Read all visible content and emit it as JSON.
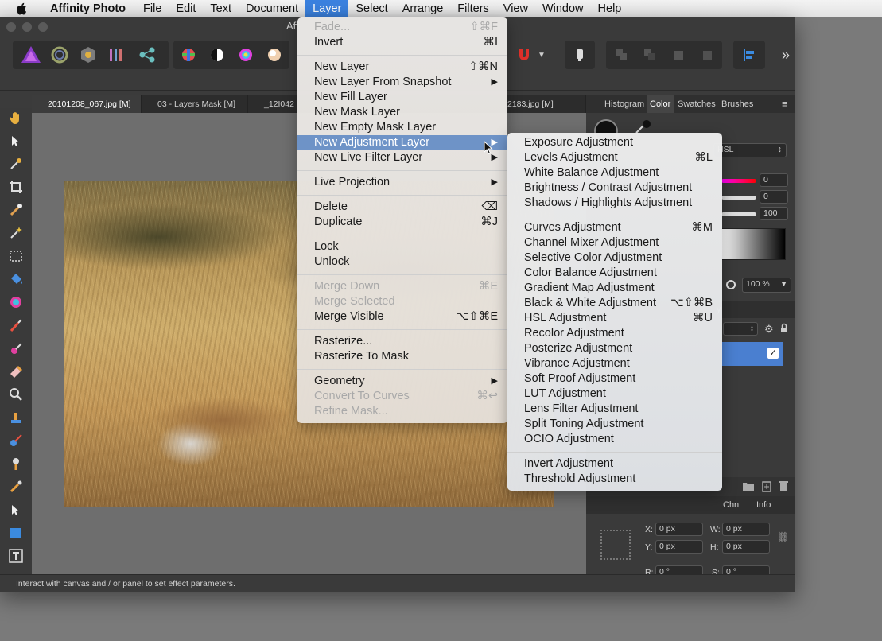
{
  "menubar": {
    "app": "Affinity Photo",
    "items": [
      "File",
      "Edit",
      "Text",
      "Document",
      "Layer",
      "Select",
      "Arrange",
      "Filters",
      "View",
      "Window",
      "Help"
    ]
  },
  "window": {
    "title": "Aff"
  },
  "doc_tabs": [
    "20101208_067.jpg [M]",
    "03 - Layers Mask [M]",
    "_12I042",
    "2183.jpg [M]"
  ],
  "right_panel": {
    "tabs": [
      "Histogram",
      "Color",
      "Swatches",
      "Brushes"
    ],
    "color_model": "HSL",
    "slider_values": [
      "0",
      "0",
      "100"
    ],
    "opacity": "100 %",
    "layers_tab_fragment": "y",
    "bottom_tabs": [
      "Chn",
      "Info"
    ],
    "transform": {
      "x_label": "X:",
      "x": "0 px",
      "y_label": "Y:",
      "y": "0 px",
      "w_label": "W:",
      "w": "0 px",
      "h_label": "H:",
      "h": "0 px",
      "r_label": "R:",
      "r": "0 °",
      "s_label": "S:",
      "s": "0 °"
    }
  },
  "status": "Interact with canvas and / or panel to set effect parameters.",
  "layer_menu": {
    "items": [
      {
        "label": "Fade...",
        "shortcut": "⇧⌘F",
        "disabled": true
      },
      {
        "label": "Invert",
        "shortcut": "⌘I"
      },
      {
        "label": "New Layer",
        "shortcut": "⇧⌘N"
      },
      {
        "label": "New Layer From Snapshot",
        "submenu": true
      },
      {
        "label": "New Fill Layer"
      },
      {
        "label": "New Mask Layer"
      },
      {
        "label": "New Empty Mask Layer"
      },
      {
        "label": "New Adjustment Layer",
        "submenu": true,
        "highlighted": true
      },
      {
        "label": "New Live Filter Layer",
        "submenu": true
      },
      {
        "label": "Live Projection",
        "submenu": true
      },
      {
        "label": "Delete",
        "shortcut": "⌫"
      },
      {
        "label": "Duplicate",
        "shortcut": "⌘J"
      },
      {
        "label": "Lock"
      },
      {
        "label": "Unlock"
      },
      {
        "label": "Merge Down",
        "shortcut": "⌘E",
        "disabled": true
      },
      {
        "label": "Merge Selected",
        "disabled": true
      },
      {
        "label": "Merge Visible",
        "shortcut": "⌥⇧⌘E"
      },
      {
        "label": "Rasterize..."
      },
      {
        "label": "Rasterize To Mask"
      },
      {
        "label": "Geometry",
        "submenu": true
      },
      {
        "label": "Convert To Curves",
        "shortcut": "⌘↩",
        "disabled": true
      },
      {
        "label": "Refine Mask...",
        "disabled": true
      }
    ]
  },
  "adjustment_menu": {
    "items": [
      {
        "label": "Exposure Adjustment"
      },
      {
        "label": "Levels Adjustment",
        "shortcut": "⌘L"
      },
      {
        "label": "White Balance Adjustment"
      },
      {
        "label": "Brightness / Contrast Adjustment"
      },
      {
        "label": "Shadows / Highlights Adjustment"
      },
      {
        "label": "Curves Adjustment",
        "shortcut": "⌘M"
      },
      {
        "label": "Channel Mixer Adjustment"
      },
      {
        "label": "Selective Color Adjustment"
      },
      {
        "label": "Color Balance Adjustment"
      },
      {
        "label": "Gradient Map Adjustment"
      },
      {
        "label": "Black & White Adjustment",
        "shortcut": "⌥⇧⌘B"
      },
      {
        "label": "HSL Adjustment",
        "shortcut": "⌘U"
      },
      {
        "label": "Recolor Adjustment"
      },
      {
        "label": "Posterize Adjustment"
      },
      {
        "label": "Vibrance Adjustment"
      },
      {
        "label": "Soft Proof Adjustment"
      },
      {
        "label": "LUT Adjustment"
      },
      {
        "label": "Lens Filter Adjustment"
      },
      {
        "label": "Split Toning Adjustment"
      },
      {
        "label": "OCIO Adjustment"
      },
      {
        "label": "Invert Adjustment"
      },
      {
        "label": "Threshold Adjustment"
      }
    ]
  },
  "colors": {
    "menu_highlight": "#6e93c7",
    "menubar_active": "#3b82e0",
    "layer_selected": "#4a7fd0"
  }
}
